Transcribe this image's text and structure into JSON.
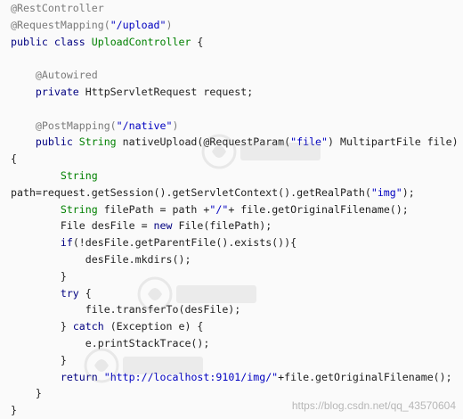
{
  "code_lines": [
    [
      {
        "t": "@RestController",
        "c": "ann"
      }
    ],
    [
      {
        "t": "@RequestMapping(",
        "c": "ann"
      },
      {
        "t": "\"/upload\"",
        "c": "str"
      },
      {
        "t": ")",
        "c": "ann"
      }
    ],
    [
      {
        "t": "public class ",
        "c": "kw"
      },
      {
        "t": "UploadController ",
        "c": "type"
      },
      {
        "t": "{",
        "c": "id"
      }
    ],
    [],
    [
      {
        "t": "    @Autowired",
        "c": "ann"
      }
    ],
    [
      {
        "t": "    private ",
        "c": "kw"
      },
      {
        "t": "HttpServletRequest request;",
        "c": "id"
      }
    ],
    [],
    [
      {
        "t": "    @PostMapping(",
        "c": "ann"
      },
      {
        "t": "\"/native\"",
        "c": "str"
      },
      {
        "t": ")",
        "c": "ann"
      }
    ],
    [
      {
        "t": "    public ",
        "c": "kw"
      },
      {
        "t": "String ",
        "c": "type"
      },
      {
        "t": "nativeUpload(@RequestParam(",
        "c": "id"
      },
      {
        "t": "\"file\"",
        "c": "str"
      },
      {
        "t": ") MultipartFile file)",
        "c": "id"
      }
    ],
    [
      {
        "t": "{",
        "c": "id"
      }
    ],
    [
      {
        "t": "        String",
        "c": "type"
      }
    ],
    [
      {
        "t": "path=request.getSession().getServletContext().getRealPath(",
        "c": "id"
      },
      {
        "t": "\"img\"",
        "c": "str"
      },
      {
        "t": ");",
        "c": "id"
      }
    ],
    [
      {
        "t": "        String ",
        "c": "type"
      },
      {
        "t": "filePath = path +",
        "c": "id"
      },
      {
        "t": "\"/\"",
        "c": "str"
      },
      {
        "t": "+ file.getOriginalFilename();",
        "c": "id"
      }
    ],
    [
      {
        "t": "        File desFile = ",
        "c": "id"
      },
      {
        "t": "new ",
        "c": "kw"
      },
      {
        "t": "File(filePath);",
        "c": "id"
      }
    ],
    [
      {
        "t": "        ",
        "c": "id"
      },
      {
        "t": "if",
        "c": "kw"
      },
      {
        "t": "(!desFile.getParentFile().exists()){",
        "c": "id"
      }
    ],
    [
      {
        "t": "            desFile.mkdirs();",
        "c": "id"
      }
    ],
    [
      {
        "t": "        }",
        "c": "id"
      }
    ],
    [
      {
        "t": "        ",
        "c": "id"
      },
      {
        "t": "try ",
        "c": "kw"
      },
      {
        "t": "{",
        "c": "id"
      }
    ],
    [
      {
        "t": "            file.transferTo(desFile);",
        "c": "id"
      }
    ],
    [
      {
        "t": "        } ",
        "c": "id"
      },
      {
        "t": "catch ",
        "c": "kw"
      },
      {
        "t": "(Exception e) {",
        "c": "id"
      }
    ],
    [
      {
        "t": "            e.printStackTrace();",
        "c": "id"
      }
    ],
    [
      {
        "t": "        }",
        "c": "id"
      }
    ],
    [
      {
        "t": "        ",
        "c": "id"
      },
      {
        "t": "return ",
        "c": "kw"
      },
      {
        "t": "\"http://localhost:9101/img/\"",
        "c": "str"
      },
      {
        "t": "+file.getOriginalFilename();",
        "c": "id"
      }
    ],
    [
      {
        "t": "    }",
        "c": "id"
      }
    ],
    [
      {
        "t": "}",
        "c": "id"
      }
    ]
  ],
  "watermark": {
    "text": "https://blog.csdn.net/qq_43570604"
  },
  "icons": [
    "logo-watermark-icon"
  ]
}
